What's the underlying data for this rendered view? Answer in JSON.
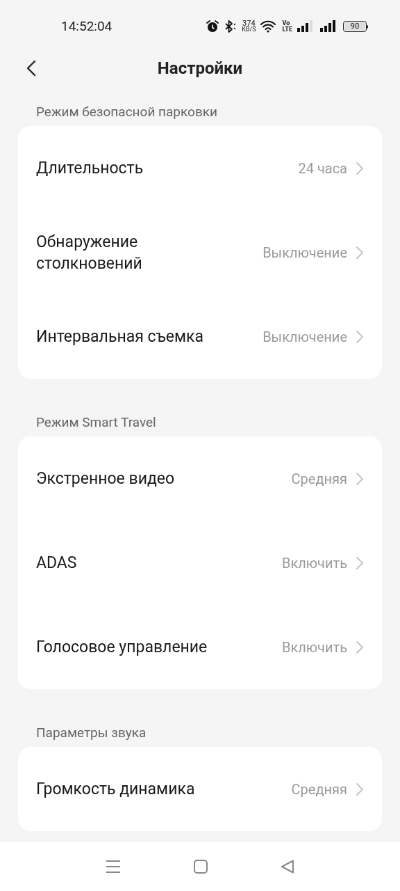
{
  "status_bar": {
    "time": "14:52:04",
    "speed_value": "374",
    "speed_unit": "KB/S",
    "volte_top": "Vo",
    "volte_bottom": "LTE",
    "battery": "90"
  },
  "header": {
    "title": "Настройки"
  },
  "sections": [
    {
      "label": "Режим безопасной парковки",
      "rows": [
        {
          "title": "Длительность",
          "value": "24 часа"
        },
        {
          "title": "Обнаружение столкновений",
          "value": "Выключение"
        },
        {
          "title": "Интервальная съемка",
          "value": "Выключение"
        }
      ]
    },
    {
      "label": "Режим Smart Travel",
      "rows": [
        {
          "title": "Экстренное видео",
          "value": "Средняя"
        },
        {
          "title": "ADAS",
          "value": "Включить"
        },
        {
          "title": "Голосовое управление",
          "value": "Включить"
        }
      ]
    },
    {
      "label": "Параметры звука",
      "rows": [
        {
          "title": "Громкость динамика",
          "value": "Средняя"
        }
      ]
    }
  ]
}
